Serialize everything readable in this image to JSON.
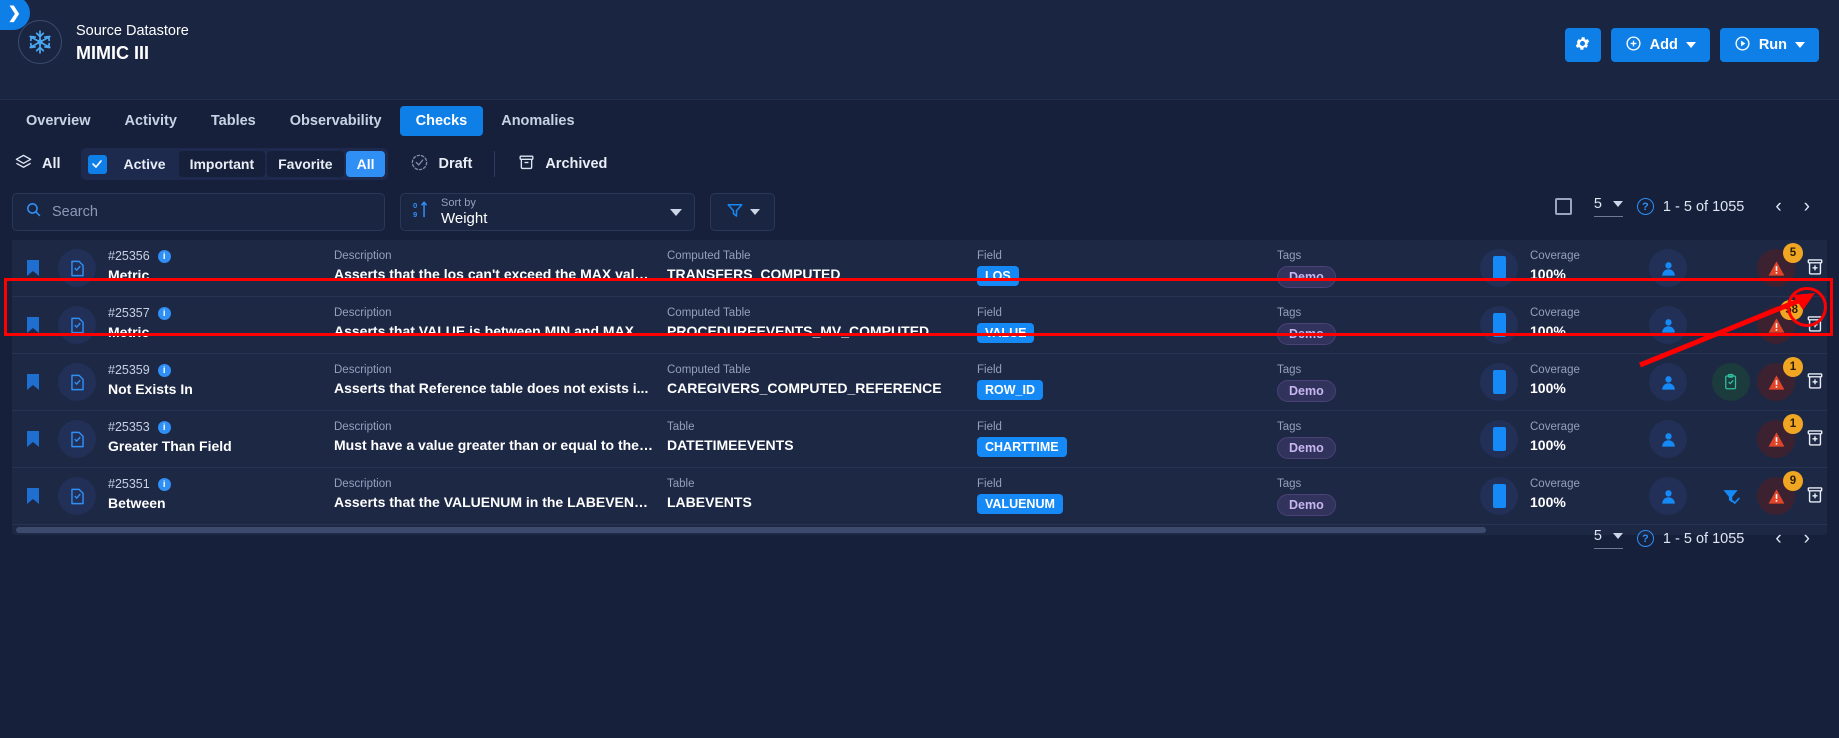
{
  "header": {
    "collapse_icon": "chevron-right-icon",
    "datastore_label": "Source Datastore",
    "datastore_name": "MIMIC III",
    "logo_icon": "snowflake-icon",
    "settings_label": "",
    "settings_icon": "gear-icon",
    "add_label": "Add",
    "add_icon": "plus-circle-icon",
    "run_label": "Run",
    "run_icon": "play-circle-icon"
  },
  "nav": {
    "tabs": [
      {
        "label": "Overview",
        "active": false
      },
      {
        "label": "Activity",
        "active": false
      },
      {
        "label": "Tables",
        "active": false
      },
      {
        "label": "Observability",
        "active": false
      },
      {
        "label": "Checks",
        "active": true
      },
      {
        "label": "Anomalies",
        "active": false
      }
    ]
  },
  "filters": {
    "all_label": "All",
    "layers_icon": "layers-icon",
    "active_label": "Active",
    "important_label": "Important",
    "favorite_label": "Favorite",
    "state_all_label": "All",
    "draft_label": "Draft",
    "draft_icon": "check-circle-dashed-icon",
    "archived_label": "Archived",
    "archived_icon": "archive-icon"
  },
  "search": {
    "placeholder": "Search",
    "value": "",
    "icon": "search-icon"
  },
  "sort": {
    "label": "Sort by",
    "value": "Weight",
    "icon": "sort-icon"
  },
  "filter_button": {
    "icon": "funnel-icon"
  },
  "pagination_top": {
    "select_all_icon": "checkbox-unchecked-icon",
    "page_size": "5",
    "help_icon": "help-icon",
    "range": "1 - 5 of 1055",
    "prev_icon": "chevron-left-icon",
    "next_icon": "chevron-right-icon"
  },
  "pagination_bottom": {
    "page_size": "5",
    "help_icon": "help-icon",
    "range": "1 - 5 of 1055",
    "prev_icon": "chevron-left-icon",
    "next_icon": "chevron-right-icon"
  },
  "table": {
    "labels": {
      "description": "Description",
      "computed_table": "Computed Table",
      "table": "Table",
      "field": "Field",
      "tags": "Tags",
      "coverage": "Coverage"
    },
    "rows": [
      {
        "id": "#25356",
        "type": "Metric",
        "description": "Asserts that the los can't exceed the MAX valu...",
        "table_label": "Computed Table",
        "table_name": "TRANSFERS_COMPUTED",
        "field_label": "Field",
        "field": "LOS",
        "tags_label": "Tags",
        "tag": "Demo",
        "coverage_label": "Coverage",
        "coverage": "100%",
        "alert_count": "5",
        "extra_icon": "",
        "highlighted": true
      },
      {
        "id": "#25357",
        "type": "Metric",
        "description": "Asserts that VALUE is between MIN and MAX",
        "table_label": "Computed Table",
        "table_name": "PROCEDUREEVENTS_MV_COMPUTED",
        "field_label": "Field",
        "field": "VALUE",
        "tags_label": "Tags",
        "tag": "Demo",
        "coverage_label": "Coverage",
        "coverage": "100%",
        "alert_count": "58",
        "extra_icon": "",
        "highlighted": false
      },
      {
        "id": "#25359",
        "type": "Not Exists In",
        "description": "Asserts that Reference table does not exists i...",
        "table_label": "Computed Table",
        "table_name": "CAREGIVERS_COMPUTED_REFERENCE",
        "field_label": "Field",
        "field": "ROW_ID",
        "tags_label": "Tags",
        "tag": "Demo",
        "coverage_label": "Coverage",
        "coverage": "100%",
        "alert_count": "1",
        "extra_icon": "clipboard-check-icon",
        "highlighted": false
      },
      {
        "id": "#25353",
        "type": "Greater Than Field",
        "description": "Must have a value greater than or equal to the ...",
        "table_label": "Table",
        "table_name": "DATETIMEEVENTS",
        "field_label": "Field",
        "field": "CHARTTIME",
        "tags_label": "Tags",
        "tag": "Demo",
        "coverage_label": "Coverage",
        "coverage": "100%",
        "alert_count": "1",
        "extra_icon": "",
        "highlighted": false
      },
      {
        "id": "#25351",
        "type": "Between",
        "description": "Asserts that the VALUENUM in the LABEVENTS...",
        "table_label": "Table",
        "table_name": "LABEVENTS",
        "field_label": "Field",
        "field": "VALUENUM",
        "tags_label": "Tags",
        "tag": "Demo",
        "coverage_label": "Coverage",
        "coverage": "100%",
        "alert_count": "9",
        "extra_icon": "funnel-check-icon",
        "highlighted": false
      }
    ]
  },
  "colors": {
    "accent": "#0f7fe8",
    "bg": "#16203a",
    "panel": "#1a2542",
    "row": "#1d2845",
    "chip_field": "#1589f5",
    "badge": "#f0a623",
    "alert": "#e0452a",
    "annotation": "#ff0000"
  }
}
